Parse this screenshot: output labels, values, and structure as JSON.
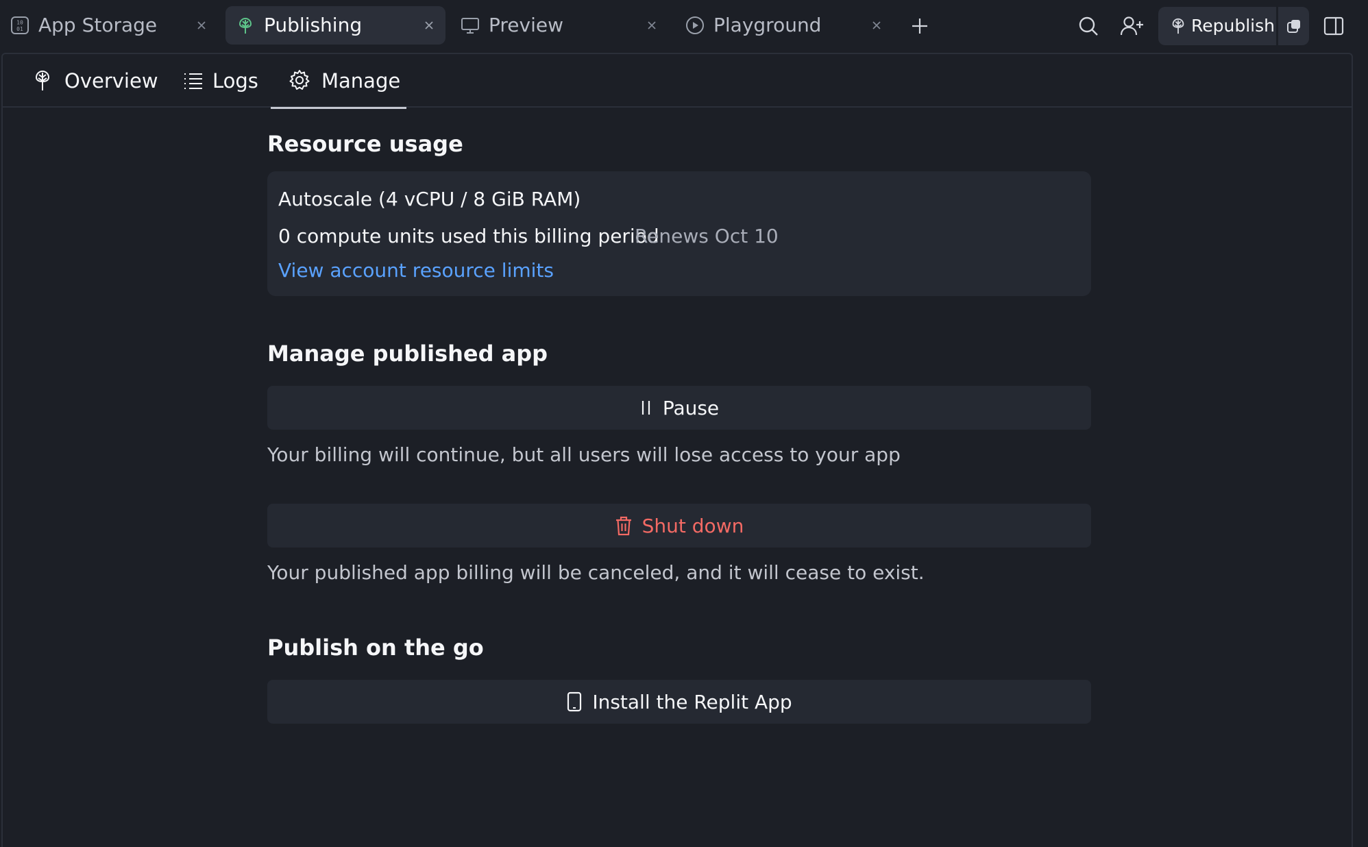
{
  "tabs": [
    {
      "label": "App Storage",
      "icon": "binary-storage-icon",
      "active": false
    },
    {
      "label": "Publishing",
      "icon": "publishing-tree-icon",
      "active": true
    },
    {
      "label": "Preview",
      "icon": "monitor-icon",
      "active": false
    },
    {
      "label": "Playground",
      "icon": "play-circle-icon",
      "active": false
    }
  ],
  "toolbar": {
    "republish_label": "Republish"
  },
  "subtabs": [
    {
      "label": "Overview",
      "icon": "publishing-tree-icon"
    },
    {
      "label": "Logs",
      "icon": "list-icon"
    },
    {
      "label": "Manage",
      "icon": "gear-icon",
      "active": true
    }
  ],
  "resource_usage": {
    "title": "Resource usage",
    "plan": "Autoscale (4 vCPU / 8 GiB RAM)",
    "usage": "0 compute units used this billing period",
    "renews": "Renews Oct 10",
    "limits_link": "View account resource limits"
  },
  "manage": {
    "title": "Manage published app",
    "pause_label": "Pause",
    "pause_help": "Your billing will continue, but all users will lose access to your app",
    "shutdown_label": "Shut down",
    "shutdown_help": "Your published app billing will be canceled, and it will cease to exist."
  },
  "publish_go": {
    "title": "Publish on the go",
    "install_label": "Install the Replit App"
  },
  "colors": {
    "background": "#1c1f26",
    "card": "#252932",
    "link": "#5aa2ff",
    "danger": "#f36a64",
    "publishing_accent": "#5ec48a"
  }
}
